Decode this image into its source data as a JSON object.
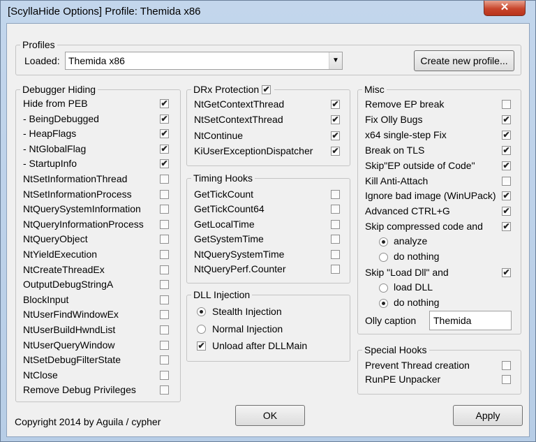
{
  "window": {
    "title": "[ScyllaHide Options] Profile: Themida x86",
    "close_glyph": "✕"
  },
  "profiles": {
    "legend": "Profiles",
    "loaded_label": "Loaded:",
    "selected": "Themida x86",
    "create_button": "Create new profile..."
  },
  "debugger_hiding": {
    "legend": "Debugger Hiding",
    "items": [
      {
        "label": "Hide from PEB",
        "checked": true
      },
      {
        "label": "- BeingDebugged",
        "checked": true
      },
      {
        "label": "- HeapFlags",
        "checked": true
      },
      {
        "label": "- NtGlobalFlag",
        "checked": true
      },
      {
        "label": "- StartupInfo",
        "checked": true
      },
      {
        "label": "NtSetInformationThread",
        "checked": false
      },
      {
        "label": "NtSetInformationProcess",
        "checked": false
      },
      {
        "label": "NtQuerySystemInformation",
        "checked": false
      },
      {
        "label": "NtQueryInformationProcess",
        "checked": false
      },
      {
        "label": "NtQueryObject",
        "checked": false
      },
      {
        "label": "NtYieldExecution",
        "checked": false
      },
      {
        "label": "NtCreateThreadEx",
        "checked": false
      },
      {
        "label": "OutputDebugStringA",
        "checked": false
      },
      {
        "label": "BlockInput",
        "checked": false
      },
      {
        "label": "NtUserFindWindowEx",
        "checked": false
      },
      {
        "label": "NtUserBuildHwndList",
        "checked": false
      },
      {
        "label": "NtUserQueryWindow",
        "checked": false
      },
      {
        "label": "NtSetDebugFilterState",
        "checked": false
      },
      {
        "label": "NtClose",
        "checked": false
      },
      {
        "label": "Remove Debug Privileges",
        "checked": false
      }
    ]
  },
  "drx_protection": {
    "legend": "DRx Protection",
    "enabled": true,
    "items": [
      {
        "label": "NtGetContextThread",
        "checked": true
      },
      {
        "label": "NtSetContextThread",
        "checked": true
      },
      {
        "label": "NtContinue",
        "checked": true
      },
      {
        "label": "KiUserExceptionDispatcher",
        "checked": true
      }
    ]
  },
  "timing_hooks": {
    "legend": "Timing Hooks",
    "items": [
      {
        "label": "GetTickCount",
        "checked": false
      },
      {
        "label": "GetTickCount64",
        "checked": false
      },
      {
        "label": "GetLocalTime",
        "checked": false
      },
      {
        "label": "GetSystemTime",
        "checked": false
      },
      {
        "label": "NtQuerySystemTime",
        "checked": false
      },
      {
        "label": "NtQueryPerf.Counter",
        "checked": false
      }
    ]
  },
  "dll_injection": {
    "legend": "DLL Injection",
    "stealth": "Stealth Injection",
    "normal": "Normal Injection",
    "stealth_selected": true,
    "unload": "Unload after DLLMain",
    "unload_checked": true
  },
  "misc": {
    "legend": "Misc",
    "items": [
      {
        "label": "Remove EP break",
        "checked": false
      },
      {
        "label": "Fix Olly Bugs",
        "checked": true
      },
      {
        "label": "x64 single-step Fix",
        "checked": true
      },
      {
        "label": "Break on TLS",
        "checked": true
      },
      {
        "label": "Skip\"EP outside of Code\"",
        "checked": true
      },
      {
        "label": "Kill Anti-Attach",
        "checked": false
      },
      {
        "label": "Ignore bad image (WinUPack)",
        "checked": true
      },
      {
        "label": "Advanced CTRL+G",
        "checked": true
      },
      {
        "label": "Skip compressed code and",
        "checked": true
      }
    ],
    "compressed_analyze": "analyze",
    "compressed_nothing": "do nothing",
    "compressed_selected": "analyze",
    "skip_load_dll": "Skip \"Load Dll\" and",
    "skip_load_dll_checked": true,
    "load_dll": "load DLL",
    "load_dll_nothing": "do nothing",
    "load_dll_selected": "do nothing",
    "olly_caption_label": "Olly caption",
    "olly_caption_value": "Themida"
  },
  "special_hooks": {
    "legend": "Special Hooks",
    "items": [
      {
        "label": "Prevent Thread creation",
        "checked": false
      },
      {
        "label": "RunPE Unpacker",
        "checked": false
      }
    ]
  },
  "footer": {
    "copyright": "Copyright 2014 by Aguila / cypher",
    "ok_button": "OK",
    "apply_button": "Apply"
  },
  "check_glyph": "✔"
}
